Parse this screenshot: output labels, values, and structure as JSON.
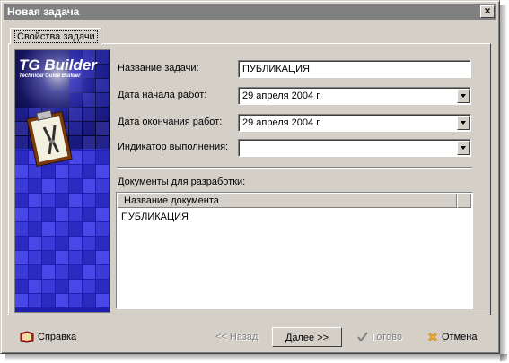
{
  "window": {
    "title": "Новая задача",
    "close_glyph": "×"
  },
  "tab": {
    "label": "Свойства задачи"
  },
  "banner": {
    "logo_text": "TG Builder",
    "logo_subtitle": "Technical Guide Builder"
  },
  "form": {
    "task_name": {
      "label": "Название задачи:",
      "value": "ПУБЛИКАЦИЯ"
    },
    "start_date": {
      "label": "Дата начала работ:",
      "value": "29  апреля   2004 г."
    },
    "end_date": {
      "label": "Дата окончания работ:",
      "value": "29  апреля   2004 г."
    },
    "progress": {
      "label": "Индикатор выполнения:",
      "value": ""
    }
  },
  "documents": {
    "label": "Документы для разработки:",
    "column_header": "Название документа",
    "rows": [
      "ПУБЛИКАЦИЯ"
    ]
  },
  "buttons": {
    "help": "Справка",
    "back": "<< Назад",
    "next": "Далее >>",
    "done": "Готово",
    "cancel": "Отмена"
  },
  "colors": {
    "banner_blue": "#1a1aa0",
    "accent_red": "#c02020",
    "check_gray": "#808080"
  }
}
